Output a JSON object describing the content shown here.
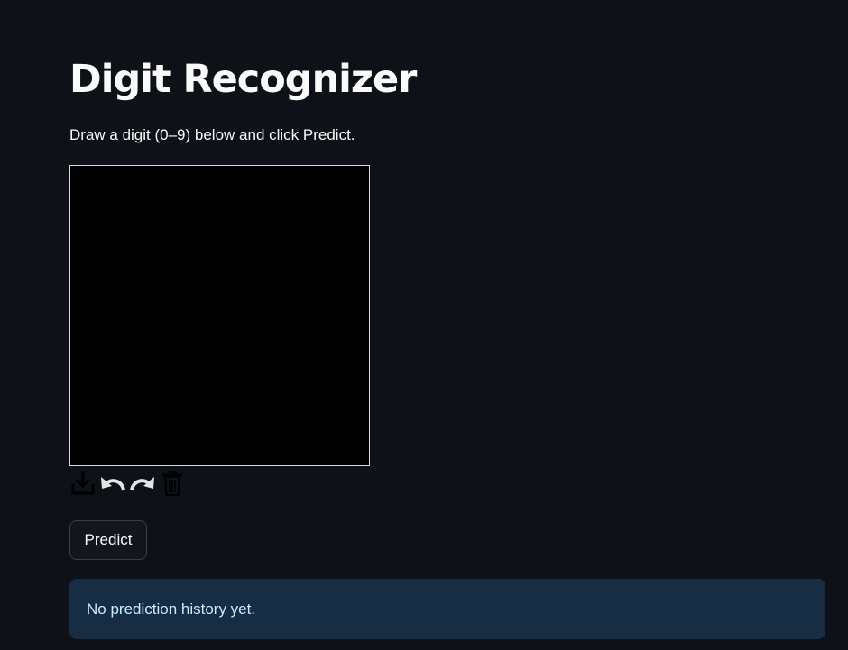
{
  "header": {
    "title": "Digit Recognizer",
    "subtitle": "Draw a digit (0–9) below and click Predict."
  },
  "canvas": {
    "background": "#000000",
    "toolbar": [
      {
        "icon": "download-icon"
      },
      {
        "icon": "undo-icon"
      },
      {
        "icon": "redo-icon"
      },
      {
        "icon": "trash-icon"
      }
    ]
  },
  "actions": {
    "predict_label": "Predict"
  },
  "history": {
    "message": "No prediction history yet."
  },
  "colors": {
    "background": "#0e1117",
    "info_background": "#172d43",
    "info_text": "#c7ebff",
    "button_border": "#3b3e47"
  }
}
